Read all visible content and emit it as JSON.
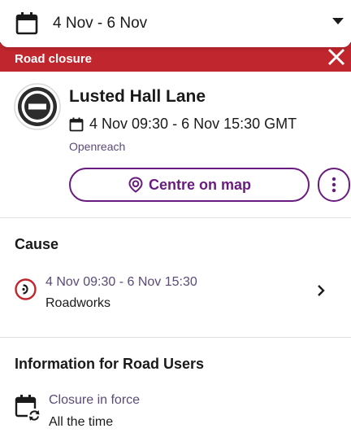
{
  "datebar": {
    "date_range": "4 Nov - 6 Nov",
    "icon": "calendar-icon",
    "dropdown_icon": "chevron-down-icon"
  },
  "header": {
    "title": "Road closure",
    "close_icon": "close-icon",
    "color": "#c0262d"
  },
  "incident": {
    "icon": "no-entry-icon",
    "road_name": "Lusted Hall Lane",
    "time_range": "4 Nov 09:30 - 6 Nov 15:30 GMT",
    "operator": "Openreach",
    "centre_button_label": "Centre on map",
    "more_icon": "more-vertical-icon",
    "accent_color": "#6a1b7f"
  },
  "cause": {
    "heading": "Cause",
    "time_range": "4 Nov 09:30 - 6 Nov 15:30",
    "type": "Roadworks",
    "icon": "roadworks-icon"
  },
  "info": {
    "heading": "Information for Road Users",
    "label": "Closure in force",
    "value": "All the time",
    "icon": "recurring-calendar-icon"
  }
}
